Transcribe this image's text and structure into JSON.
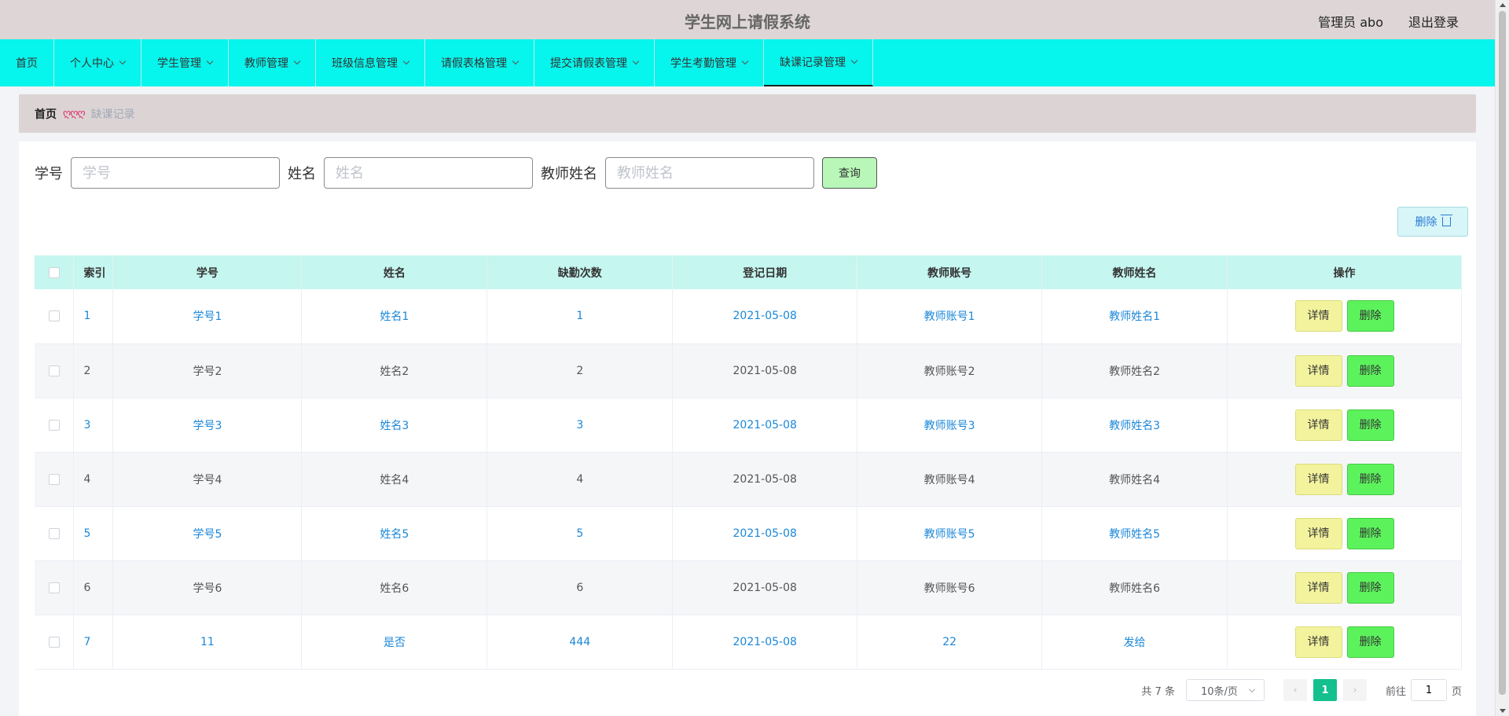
{
  "header": {
    "title": "学生网上请假系统",
    "user": "管理员 abo",
    "logout": "退出登录"
  },
  "nav": [
    {
      "label": "首页",
      "dropdown": false
    },
    {
      "label": "个人中心",
      "dropdown": true
    },
    {
      "label": "学生管理",
      "dropdown": true
    },
    {
      "label": "教师管理",
      "dropdown": true
    },
    {
      "label": "班级信息管理",
      "dropdown": true
    },
    {
      "label": "请假表格管理",
      "dropdown": true
    },
    {
      "label": "提交请假表管理",
      "dropdown": true
    },
    {
      "label": "学生考勤管理",
      "dropdown": true
    },
    {
      "label": "缺课记录管理",
      "dropdown": true,
      "active": true
    }
  ],
  "breadcrumb": {
    "home": "首页",
    "separator": "ღღღ",
    "current": "缺课记录"
  },
  "search": {
    "student_no_label": "学号",
    "student_no_placeholder": "学号",
    "name_label": "姓名",
    "name_placeholder": "姓名",
    "teacher_name_label": "教师姓名",
    "teacher_name_placeholder": "教师姓名",
    "query_button": "查询"
  },
  "toolbar": {
    "delete_label": "删除"
  },
  "table": {
    "columns": [
      "索引",
      "学号",
      "姓名",
      "缺勤次数",
      "登记日期",
      "教师账号",
      "教师姓名",
      "操作"
    ],
    "rows": [
      {
        "index": "1",
        "student_no": "学号1",
        "name": "姓名1",
        "absences": "1",
        "date": "2021-05-08",
        "teacher_account": "教师账号1",
        "teacher_name": "教师姓名1"
      },
      {
        "index": "2",
        "student_no": "学号2",
        "name": "姓名2",
        "absences": "2",
        "date": "2021-05-08",
        "teacher_account": "教师账号2",
        "teacher_name": "教师姓名2"
      },
      {
        "index": "3",
        "student_no": "学号3",
        "name": "姓名3",
        "absences": "3",
        "date": "2021-05-08",
        "teacher_account": "教师账号3",
        "teacher_name": "教师姓名3"
      },
      {
        "index": "4",
        "student_no": "学号4",
        "name": "姓名4",
        "absences": "4",
        "date": "2021-05-08",
        "teacher_account": "教师账号4",
        "teacher_name": "教师姓名4"
      },
      {
        "index": "5",
        "student_no": "学号5",
        "name": "姓名5",
        "absences": "5",
        "date": "2021-05-08",
        "teacher_account": "教师账号5",
        "teacher_name": "教师姓名5"
      },
      {
        "index": "6",
        "student_no": "学号6",
        "name": "姓名6",
        "absences": "6",
        "date": "2021-05-08",
        "teacher_account": "教师账号6",
        "teacher_name": "教师姓名6"
      },
      {
        "index": "7",
        "student_no": "11",
        "name": "是否",
        "absences": "444",
        "date": "2021-05-08",
        "teacher_account": "22",
        "teacher_name": "发给"
      }
    ],
    "detail_label": "详情",
    "remove_label": "删除"
  },
  "pagination": {
    "total": "共 7 条",
    "page_size": "10条/页",
    "current_page": "1",
    "goto_prefix": "前往",
    "goto_value": "1",
    "goto_suffix": "页"
  },
  "colors": {
    "nav_bg": "#06f5ec",
    "header_bg": "#ded6d6",
    "link": "#1b87d8",
    "active_page": "#13c08e",
    "remove_button": "#5cf25c",
    "detail_button": "#f3f39e"
  }
}
